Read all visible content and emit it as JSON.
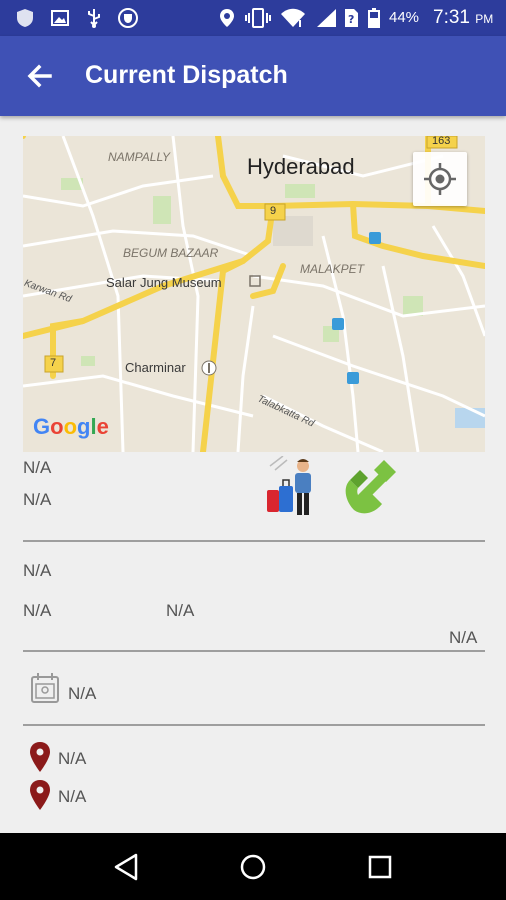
{
  "status_bar": {
    "battery": "44%",
    "time": "7:31",
    "ampm": "PM",
    "icons": [
      "shield-icon",
      "image-icon",
      "usb-icon",
      "vpn-icon",
      "location-icon",
      "vibrate-icon",
      "wifi-icon",
      "signal-icon",
      "sim-icon",
      "battery-icon"
    ]
  },
  "app_bar": {
    "title": "Current Dispatch",
    "back_icon": "arrow-back-icon"
  },
  "map": {
    "city": "Hyderabad",
    "labels": {
      "nampally": "NAMPALLY",
      "begum_bazaar": "BEGUM BAZAAR",
      "malakpet": "MALAKPET",
      "salar_jung": "Salar Jung Museum",
      "charminar": "Charminar",
      "karwan_rd": "Karwan Rd",
      "talabkatta_rd": "Talabkatta Rd"
    },
    "shields": {
      "nh9": "9",
      "nh7": "7",
      "nh163": "163"
    },
    "logo": "Google",
    "locate_icon": "my-location-icon"
  },
  "dispatch": {
    "line1": "N/A",
    "line2": "N/A",
    "passenger_icon": "passenger-luggage-icon",
    "call_icon": "phone-call-icon",
    "field_a": "N/A",
    "field_b": "N/A",
    "field_c": "N/A",
    "field_d": "N/A",
    "date_value": "N/A",
    "date_icon": "calendar-icon",
    "pickup": "N/A",
    "dropoff": "N/A",
    "pin_icon": "map-pin-icon"
  },
  "nav_bar": {
    "icons": [
      "back-triangle-icon",
      "home-circle-icon",
      "recents-square-icon"
    ]
  },
  "colors": {
    "status_bar": "#2d3c9c",
    "app_bar": "#3f51b5",
    "background": "#efefef",
    "pin": "#8b1a1a",
    "phone": "#7cc242"
  }
}
